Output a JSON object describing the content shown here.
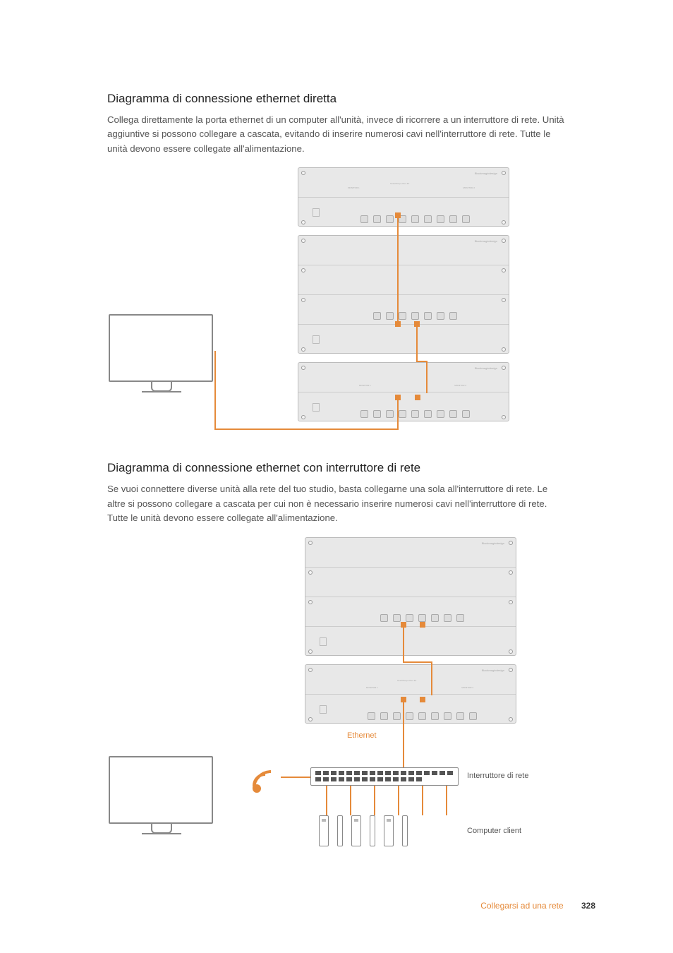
{
  "section1": {
    "heading": "Diagramma di connessione ethernet diretta",
    "body": "Collega direttamente la porta ethernet di un computer all'unità, invece di ricorrere a un interruttore di rete. Unità aggiuntive si possono collegare a cascata, evitando di inserire numerosi cavi nell'interruttore di rete. Tutte le unità devono essere collegate all'alimentazione."
  },
  "section2": {
    "heading": "Diagramma di connessione ethernet con interruttore di rete",
    "body": "Se vuoi connettere diverse unità alla rete del tuo studio, basta collegarne una sola all'interruttore di rete. Le altre si possono collegare a cascata per cui non è necessario inserire numerosi cavi nell'interruttore di rete. Tutte le unità devono essere collegate all'alimentazione."
  },
  "labels": {
    "ethernet": "Ethernet",
    "switch": "Interruttore di rete",
    "client": "Computer client",
    "brand": "Blackmagicdesign",
    "smartscope": "SmartScope Duo 4K",
    "monitor1": "MONITOR 1",
    "monitor2": "MONITOR 2"
  },
  "footer": {
    "chapter": "Collegarsi ad una rete",
    "page": "328"
  }
}
